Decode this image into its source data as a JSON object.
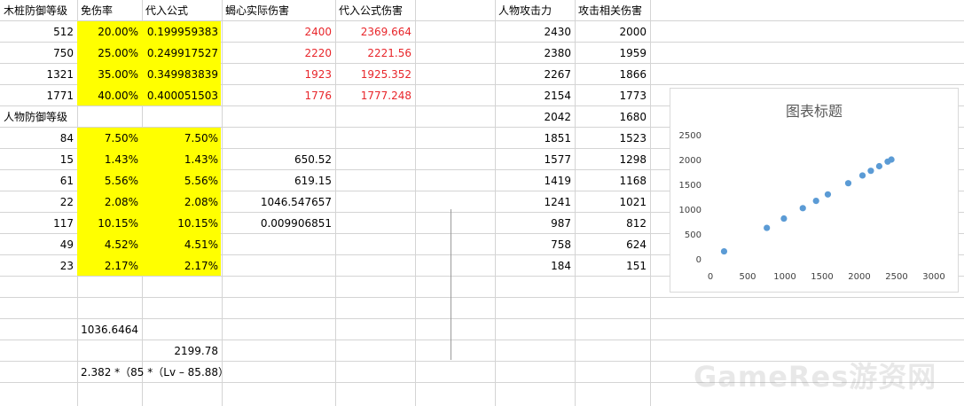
{
  "headers": {
    "A": "木桩防御等级",
    "B": "免伤率",
    "C": "代入公式",
    "D": "蝎心实际伤害",
    "E": "代入公式伤害",
    "G": "人物攻击力",
    "H": "攻击相关伤害"
  },
  "wood_rows": [
    {
      "A": "512",
      "B": "20.00%",
      "C": "0.199959383",
      "D": "2400",
      "E": "2369.664"
    },
    {
      "A": "750",
      "B": "25.00%",
      "C": "0.249917527",
      "D": "2220",
      "E": "2221.56"
    },
    {
      "A": "1321",
      "B": "35.00%",
      "C": "0.349983839",
      "D": "1923",
      "E": "1925.352"
    },
    {
      "A": "1771",
      "B": "40.00%",
      "C": "0.400051503",
      "D": "1776",
      "E": "1777.248"
    }
  ],
  "char_def_label": "人物防御等级",
  "char_rows": [
    {
      "A": "84",
      "B": "7.50%",
      "C": "7.50%",
      "D": ""
    },
    {
      "A": "15",
      "B": "1.43%",
      "C": "1.43%",
      "D": "650.52"
    },
    {
      "A": "61",
      "B": "5.56%",
      "C": "5.56%",
      "D": "619.15"
    },
    {
      "A": "22",
      "B": "2.08%",
      "C": "2.08%",
      "D": "1046.547657"
    },
    {
      "A": "117",
      "B": "10.15%",
      "C": "10.15%",
      "D": "0.009906851"
    },
    {
      "A": "49",
      "B": "4.52%",
      "C": "4.51%",
      "D": ""
    },
    {
      "A": "23",
      "B": "2.17%",
      "C": "2.17%",
      "D": ""
    }
  ],
  "extra": {
    "b16": "1036.6464",
    "c17": "2199.78",
    "formula": "2.382 *（85 *（Lv – 85.88）"
  },
  "attack_rows": [
    {
      "G": "2430",
      "H": "2000"
    },
    {
      "G": "2380",
      "H": "1959"
    },
    {
      "G": "2267",
      "H": "1866"
    },
    {
      "G": "2154",
      "H": "1773"
    },
    {
      "G": "2042",
      "H": "1680"
    },
    {
      "G": "1851",
      "H": "1523"
    },
    {
      "G": "1577",
      "H": "1298"
    },
    {
      "G": "1419",
      "H": "1168"
    },
    {
      "G": "1241",
      "H": "1021"
    },
    {
      "G": "987",
      "H": "812"
    },
    {
      "G": "758",
      "H": "624"
    },
    {
      "G": "184",
      "H": "151"
    }
  ],
  "colors": {
    "highlight": "#ffff00",
    "red_text": "#e8262b",
    "marker": "#5b9bd5",
    "grid": "#d4d4d4"
  },
  "chart_data": {
    "type": "scatter",
    "title": "图表标题",
    "x": [
      2430,
      2380,
      2267,
      2154,
      2042,
      1851,
      1577,
      1419,
      1241,
      987,
      758,
      184
    ],
    "y": [
      2000,
      1959,
      1866,
      1773,
      1680,
      1523,
      1298,
      1168,
      1021,
      812,
      624,
      151
    ],
    "xlim": [
      0,
      3000
    ],
    "ylim": [
      0,
      2500
    ],
    "xticks": [
      "0",
      "500",
      "1000",
      "1500",
      "2000",
      "2500",
      "3000"
    ],
    "yticks": [
      "0",
      "500",
      "1000",
      "1500",
      "2000",
      "2500"
    ],
    "grid": false,
    "legend": "none"
  },
  "watermark": "GameRes游资网"
}
